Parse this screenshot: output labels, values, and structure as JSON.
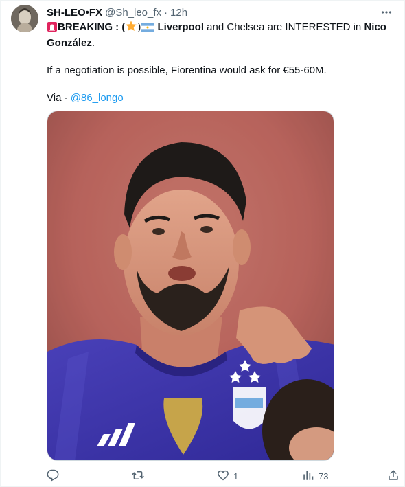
{
  "tweet": {
    "author": {
      "display_name": "SH-LEO•FX",
      "handle": "@Sh_leo_fx",
      "separator": "·",
      "time": "12h"
    },
    "body": {
      "prefix": "BREAKING : (",
      "mid": ")",
      "club1": "Liverpool",
      "connector": " and Chelsea are INTERESTED in ",
      "player": "Nico González",
      "end": ".",
      "line2": "If a negotiation is possible, Fiorentina would ask for €55-60M.",
      "via_label": "Via - ",
      "via_link": "@86_longo"
    },
    "media_alt": "Nico González in Argentina national team jersey",
    "actions": {
      "reply_count": "",
      "retweet_count": "",
      "like_count": "1",
      "views_count": "73"
    }
  },
  "icons": {
    "siren": "police-car-light-emoji",
    "star": "star-emoji",
    "flag": "argentina-flag-emoji",
    "reply": "reply-icon",
    "retweet": "retweet-icon",
    "like": "heart-icon",
    "views": "views-chart-icon",
    "share": "share-icon",
    "more": "more-dots-icon"
  },
  "colors": {
    "text": "#0f1419",
    "secondary": "#536471",
    "link": "#1d9bf0",
    "jersey": "#3b32a8"
  }
}
